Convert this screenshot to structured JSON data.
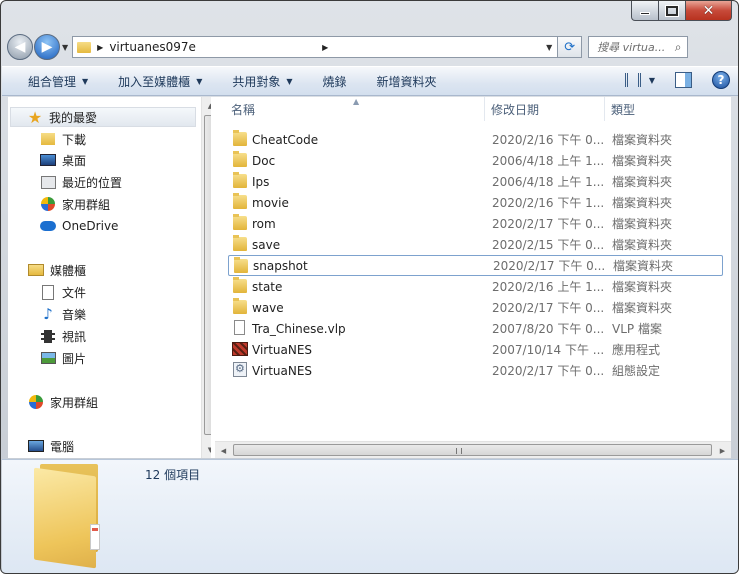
{
  "window": {
    "colors": {
      "toolbar_text": "#1e395b",
      "close_red": "#c74a3a"
    }
  },
  "address": {
    "path": "virtuanes097e",
    "search_placeholder": "搜尋 virtua..."
  },
  "toolbar": {
    "organize": "組合管理",
    "include_in_library": "加入至媒體櫃",
    "share_with": "共用對象",
    "burn": "燒錄",
    "new_folder": "新增資料夾"
  },
  "navpane": {
    "favorites": "我的最愛",
    "downloads": "下載",
    "desktop": "桌面",
    "recent": "最近的位置",
    "homegroup_fav": "家用群組",
    "onedrive": "OneDrive",
    "libraries": "媒體櫃",
    "documents": "文件",
    "music": "音樂",
    "videos": "視訊",
    "pictures": "圖片",
    "homegroup": "家用群組",
    "computer": "電腦"
  },
  "columns": {
    "name": "名稱",
    "date": "修改日期",
    "type": "類型"
  },
  "files": [
    {
      "name": "CheatCode",
      "date": "2020/2/16 下午 0...",
      "type": "檔案資料夾",
      "icon": "folder-icon"
    },
    {
      "name": "Doc",
      "date": "2006/4/18 上午 1...",
      "type": "檔案資料夾",
      "icon": "folder-icon"
    },
    {
      "name": "Ips",
      "date": "2006/4/18 上午 1...",
      "type": "檔案資料夾",
      "icon": "folder-icon"
    },
    {
      "name": "movie",
      "date": "2020/2/16 下午 1...",
      "type": "檔案資料夾",
      "icon": "folder-icon"
    },
    {
      "name": "rom",
      "date": "2020/2/17 下午 0...",
      "type": "檔案資料夾",
      "icon": "folder-icon"
    },
    {
      "name": "save",
      "date": "2020/2/15 下午 0...",
      "type": "檔案資料夾",
      "icon": "folder-icon"
    },
    {
      "name": "snapshot",
      "date": "2020/2/17 下午 0...",
      "type": "檔案資料夾",
      "icon": "folder-icon"
    },
    {
      "name": "state",
      "date": "2020/2/16 上午 1...",
      "type": "檔案資料夾",
      "icon": "folder-icon"
    },
    {
      "name": "wave",
      "date": "2020/2/17 下午 0...",
      "type": "檔案資料夾",
      "icon": "folder-icon"
    },
    {
      "name": "Tra_Chinese.vlp",
      "date": "2007/8/20 下午 0...",
      "type": "VLP 檔案",
      "icon": "file-icon"
    },
    {
      "name": "VirtuaNES",
      "date": "2007/10/14 下午 ...",
      "type": "應用程式",
      "icon": "app-icon"
    },
    {
      "name": "VirtuaNES",
      "date": "2020/2/17 下午 0...",
      "type": "組態設定",
      "icon": "config-icon"
    }
  ],
  "details": {
    "item_count": "12 個項目"
  }
}
